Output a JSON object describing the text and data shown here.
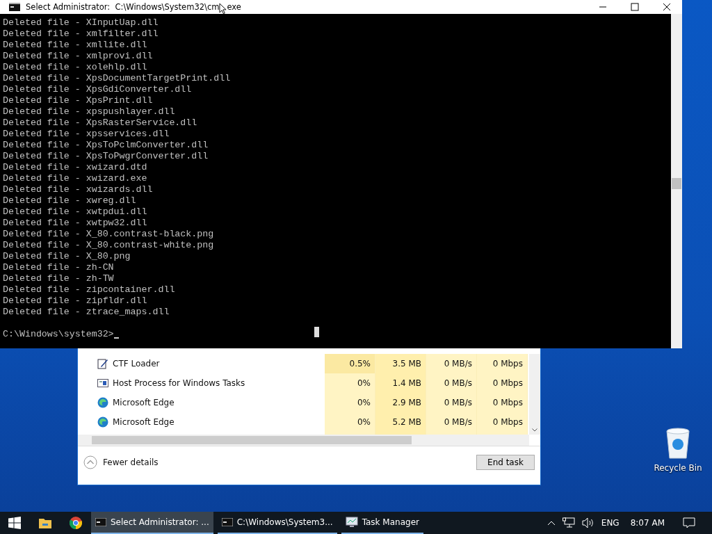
{
  "console": {
    "title": "Select Administrator:  C:\\Windows\\System32\\cm",
    "title_end": "exe",
    "lines": [
      "Deleted file - XInputUap.dll",
      "Deleted file - xmlfilter.dll",
      "Deleted file - xmllite.dll",
      "Deleted file - xmlprovi.dll",
      "Deleted file - xolehlp.dll",
      "Deleted file - XpsDocumentTargetPrint.dll",
      "Deleted file - XpsGdiConverter.dll",
      "Deleted file - XpsPrint.dll",
      "Deleted file - xpspushlayer.dll",
      "Deleted file - XpsRasterService.dll",
      "Deleted file - xpsservices.dll",
      "Deleted file - XpsToPclmConverter.dll",
      "Deleted file - XpsToPwgrConverter.dll",
      "Deleted file - xwizard.dtd",
      "Deleted file - xwizard.exe",
      "Deleted file - xwizards.dll",
      "Deleted file - xwreg.dll",
      "Deleted file - xwtpdui.dll",
      "Deleted file - xwtpw32.dll",
      "Deleted file - X_80.contrast-black.png",
      "Deleted file - X_80.contrast-white.png",
      "Deleted file - X_80.png",
      "Deleted file - zh-CN",
      "Deleted file - zh-TW",
      "Deleted file - zipcontainer.dll",
      "Deleted file - zipfldr.dll",
      "Deleted file - ztrace_maps.dll"
    ],
    "prompt": "C:\\Windows\\system32>"
  },
  "task_manager": {
    "rows": [
      {
        "kind": "pen",
        "name": "CTF Loader",
        "cpu": "0.5%",
        "memory": "3.5 MB",
        "disk": "0 MB/s",
        "network": "0 Mbps"
      },
      {
        "kind": "window",
        "name": "Host Process for Windows Tasks",
        "cpu": "0%",
        "memory": "1.4 MB",
        "disk": "0 MB/s",
        "network": "0 Mbps"
      },
      {
        "kind": "edge",
        "name": "Microsoft Edge",
        "cpu": "0%",
        "memory": "2.9 MB",
        "disk": "0 MB/s",
        "network": "0 Mbps"
      },
      {
        "kind": "edge",
        "name": "Microsoft Edge",
        "cpu": "0%",
        "memory": "5.2 MB",
        "disk": "0 MB/s",
        "network": "0 Mbps"
      }
    ],
    "fewer_details": "Fewer details",
    "end_task": "End task"
  },
  "desktop": {
    "recycle_bin": "Recycle Bin"
  },
  "taskbar": {
    "tasks": [
      {
        "label": "Select Administrator: ...",
        "selected": true
      },
      {
        "label": "C:\\Windows\\System3...",
        "selected": false
      },
      {
        "label": "Task Manager",
        "selected": false,
        "kind": "taskmgr"
      }
    ],
    "language": "ENG",
    "time": "8:07 AM"
  }
}
